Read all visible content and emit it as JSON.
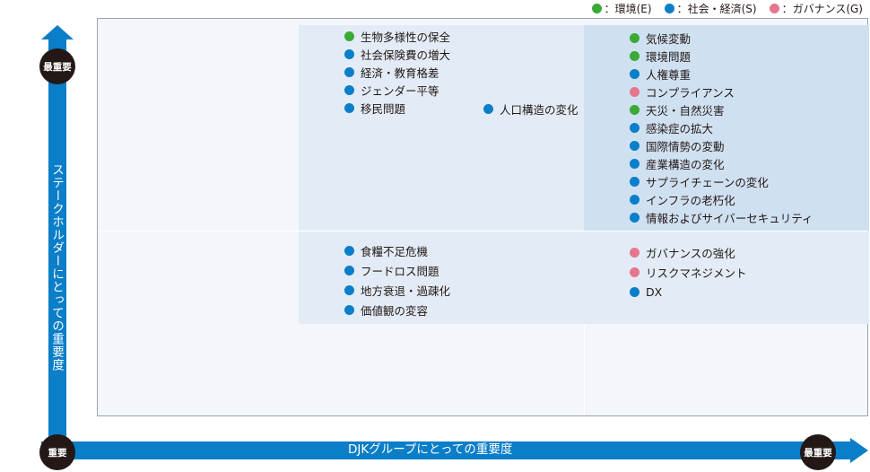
{
  "legend": [
    {
      "label": "：環境(E)",
      "category": "env",
      "color": "#3aaa35"
    },
    {
      "label": "：社会・経済(S)",
      "category": "soc",
      "color": "#0a7ec8"
    },
    {
      "label": "：ガバナンス(G)",
      "category": "gov",
      "color": "#e6768c"
    }
  ],
  "axes": {
    "y_label": "ステークホルダーにとっての重要度",
    "x_label": "DJKグループにとっての重要度",
    "y_top_badge": "最重要",
    "origin_badge": "重要",
    "x_right_badge": "最重要"
  },
  "quadrants": {
    "upper_middle": [
      {
        "label": "生物多様性の保全",
        "category": "env"
      },
      {
        "label": "社会保険費の増大",
        "category": "soc"
      },
      {
        "label": "経済・教育格差",
        "category": "soc"
      },
      {
        "label": "ジェンダー平等",
        "category": "soc"
      },
      {
        "label": "移民問題",
        "category": "soc"
      }
    ],
    "boundary": [
      {
        "label": "人口構造の変化",
        "category": "soc"
      }
    ],
    "upper_right": [
      {
        "label": "気候変動",
        "category": "env"
      },
      {
        "label": "環境問題",
        "category": "env"
      },
      {
        "label": "人権尊重",
        "category": "soc"
      },
      {
        "label": "コンプライアンス",
        "category": "gov"
      },
      {
        "label": "天災・自然災害",
        "category": "env"
      },
      {
        "label": "感染症の拡大",
        "category": "soc"
      },
      {
        "label": "国際情勢の変動",
        "category": "soc"
      },
      {
        "label": "産業構造の変化",
        "category": "soc"
      },
      {
        "label": "サプライチェーンの変化",
        "category": "soc"
      },
      {
        "label": "インフラの老朽化",
        "category": "soc"
      },
      {
        "label": "情報およびサイバーセキュリティ",
        "category": "soc"
      }
    ],
    "middle_middle": [
      {
        "label": "食糧不足危機",
        "category": "soc"
      },
      {
        "label": "フードロス問題",
        "category": "soc"
      },
      {
        "label": "地方衰退・過疎化",
        "category": "soc"
      },
      {
        "label": "価値観の変容",
        "category": "soc"
      }
    ],
    "middle_right": [
      {
        "label": "ガバナンスの強化",
        "category": "gov"
      },
      {
        "label": "リスクマネジメント",
        "category": "gov"
      },
      {
        "label": "DX",
        "category": "soc"
      }
    ]
  }
}
